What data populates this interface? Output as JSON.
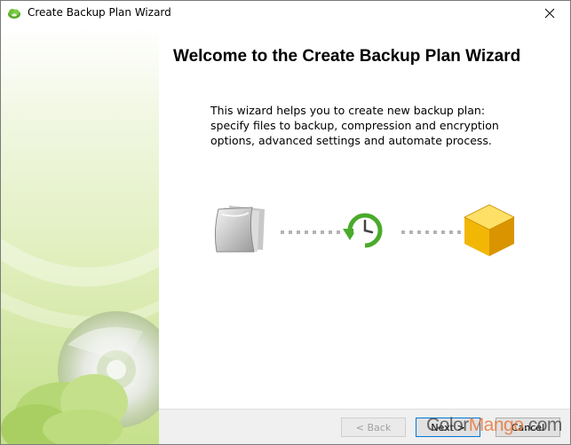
{
  "window": {
    "title": "Create Backup Plan Wizard",
    "icons": {
      "app": "green-cloud-backup-icon",
      "close": "close-icon"
    }
  },
  "main": {
    "heading": "Welcome to the Create Backup Plan Wizard",
    "description": "This wizard helps you to create new backup plan: specify files to backup, compression and encryption options, advanced settings and automate process.",
    "graphics": [
      "documents-icon",
      "restore-clock-icon",
      "yellow-cube-icon"
    ]
  },
  "footer": {
    "back_label": "< Back",
    "next_label": "Next >",
    "cancel_label": "Cancel"
  },
  "watermark": {
    "part1": "Color",
    "part2": "Mango",
    "part3": ".com"
  },
  "colors": {
    "accent_green": "#5aa82a",
    "side_panel_green": "#c6e18d",
    "cube_yellow": "#f2b705",
    "focus_blue": "#0078d7"
  }
}
